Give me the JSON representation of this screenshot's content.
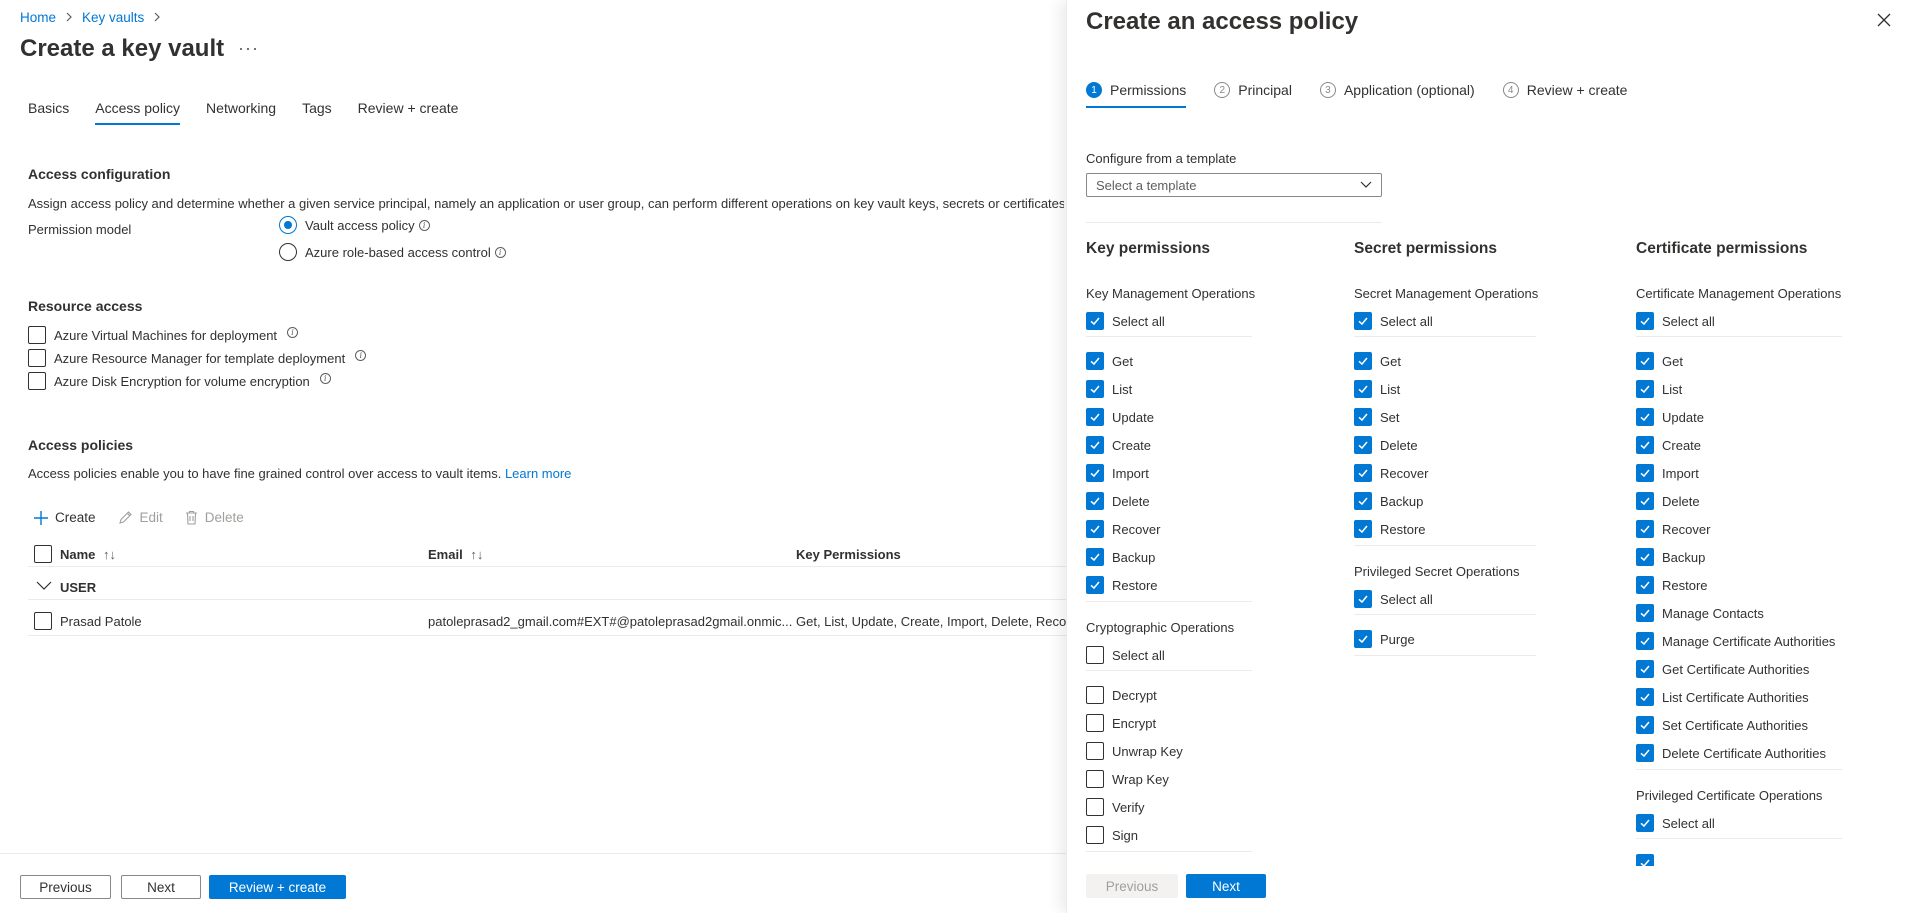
{
  "breadcrumb": {
    "home": "Home",
    "key_vaults": "Key vaults"
  },
  "page": {
    "title": "Create a key vault",
    "more": "···"
  },
  "tabs": [
    {
      "label": "Basics",
      "active": false
    },
    {
      "label": "Access policy",
      "active": true
    },
    {
      "label": "Networking",
      "active": false
    },
    {
      "label": "Tags",
      "active": false
    },
    {
      "label": "Review + create",
      "active": false
    }
  ],
  "access_config": {
    "title": "Access configuration",
    "description": "Assign access policy and determine whether a given service principal, namely an application or user group, can perform different operations on key vault keys, secrets or certificates. L",
    "permission_model_label": "Permission model",
    "options": [
      {
        "label": "Vault access policy",
        "checked": true
      },
      {
        "label": "Azure role-based access control",
        "checked": false
      }
    ]
  },
  "resource_access": {
    "title": "Resource access",
    "items": [
      {
        "label": "Azure Virtual Machines for deployment",
        "checked": false
      },
      {
        "label": "Azure Resource Manager for template deployment",
        "checked": false
      },
      {
        "label": "Azure Disk Encryption for volume encryption",
        "checked": false
      }
    ]
  },
  "access_policies": {
    "title": "Access policies",
    "description": "Access policies enable you to have fine grained control over access to vault items.",
    "learn_more": "Learn more",
    "toolbar": {
      "create": "Create",
      "edit": "Edit",
      "delete": "Delete"
    },
    "columns": {
      "name": "Name",
      "email": "Email",
      "key_permissions": "Key Permissions"
    },
    "group": "USER",
    "rows": [
      {
        "name": "Prasad Patole",
        "email": "patoleprasad2_gmail.com#EXT#@patoleprasad2gmail.onmic...",
        "key_permissions": "Get, List, Update, Create, Import, Delete, Recove"
      }
    ]
  },
  "bottom_bar": {
    "previous": "Previous",
    "next": "Next",
    "review_create": "Review + create"
  },
  "panel": {
    "title": "Create an access policy",
    "steps": [
      {
        "num": "1",
        "label": "Permissions",
        "active": true
      },
      {
        "num": "2",
        "label": "Principal",
        "active": false
      },
      {
        "num": "3",
        "label": "Application (optional)",
        "active": false
      },
      {
        "num": "4",
        "label": "Review + create",
        "active": false
      }
    ],
    "template_label": "Configure from a template",
    "template_placeholder": "Select a template",
    "key_permissions": {
      "title": "Key permissions",
      "groups": [
        {
          "title": "Key Management Operations",
          "select_all": {
            "label": "Select all",
            "checked": true
          },
          "items": [
            {
              "label": "Get",
              "checked": true
            },
            {
              "label": "List",
              "checked": true
            },
            {
              "label": "Update",
              "checked": true
            },
            {
              "label": "Create",
              "checked": true
            },
            {
              "label": "Import",
              "checked": true
            },
            {
              "label": "Delete",
              "checked": true
            },
            {
              "label": "Recover",
              "checked": true
            },
            {
              "label": "Backup",
              "checked": true
            },
            {
              "label": "Restore",
              "checked": true
            }
          ]
        },
        {
          "title": "Cryptographic Operations",
          "select_all": {
            "label": "Select all",
            "checked": false
          },
          "items": [
            {
              "label": "Decrypt",
              "checked": false
            },
            {
              "label": "Encrypt",
              "checked": false
            },
            {
              "label": "Unwrap Key",
              "checked": false
            },
            {
              "label": "Wrap Key",
              "checked": false
            },
            {
              "label": "Verify",
              "checked": false
            },
            {
              "label": "Sign",
              "checked": false
            }
          ]
        }
      ]
    },
    "secret_permissions": {
      "title": "Secret permissions",
      "groups": [
        {
          "title": "Secret Management Operations",
          "select_all": {
            "label": "Select all",
            "checked": true
          },
          "items": [
            {
              "label": "Get",
              "checked": true
            },
            {
              "label": "List",
              "checked": true
            },
            {
              "label": "Set",
              "checked": true
            },
            {
              "label": "Delete",
              "checked": true
            },
            {
              "label": "Recover",
              "checked": true
            },
            {
              "label": "Backup",
              "checked": true
            },
            {
              "label": "Restore",
              "checked": true
            }
          ]
        },
        {
          "title": "Privileged Secret Operations",
          "select_all": {
            "label": "Select all",
            "checked": true
          },
          "items": [
            {
              "label": "Purge",
              "checked": true
            }
          ]
        }
      ]
    },
    "certificate_permissions": {
      "title": "Certificate permissions",
      "groups": [
        {
          "title": "Certificate Management Operations",
          "select_all": {
            "label": "Select all",
            "checked": true
          },
          "items": [
            {
              "label": "Get",
              "checked": true
            },
            {
              "label": "List",
              "checked": true
            },
            {
              "label": "Update",
              "checked": true
            },
            {
              "label": "Create",
              "checked": true
            },
            {
              "label": "Import",
              "checked": true
            },
            {
              "label": "Delete",
              "checked": true
            },
            {
              "label": "Recover",
              "checked": true
            },
            {
              "label": "Backup",
              "checked": true
            },
            {
              "label": "Restore",
              "checked": true
            },
            {
              "label": "Manage Contacts",
              "checked": true
            },
            {
              "label": "Manage Certificate Authorities",
              "checked": true
            },
            {
              "label": "Get Certificate Authorities",
              "checked": true
            },
            {
              "label": "List Certificate Authorities",
              "checked": true
            },
            {
              "label": "Set Certificate Authorities",
              "checked": true
            },
            {
              "label": "Delete Certificate Authorities",
              "checked": true
            }
          ]
        },
        {
          "title": "Privileged Certificate Operations",
          "select_all": {
            "label": "Select all",
            "checked": true
          },
          "items": []
        }
      ]
    },
    "bottom": {
      "previous": "Previous",
      "next": "Next"
    }
  }
}
